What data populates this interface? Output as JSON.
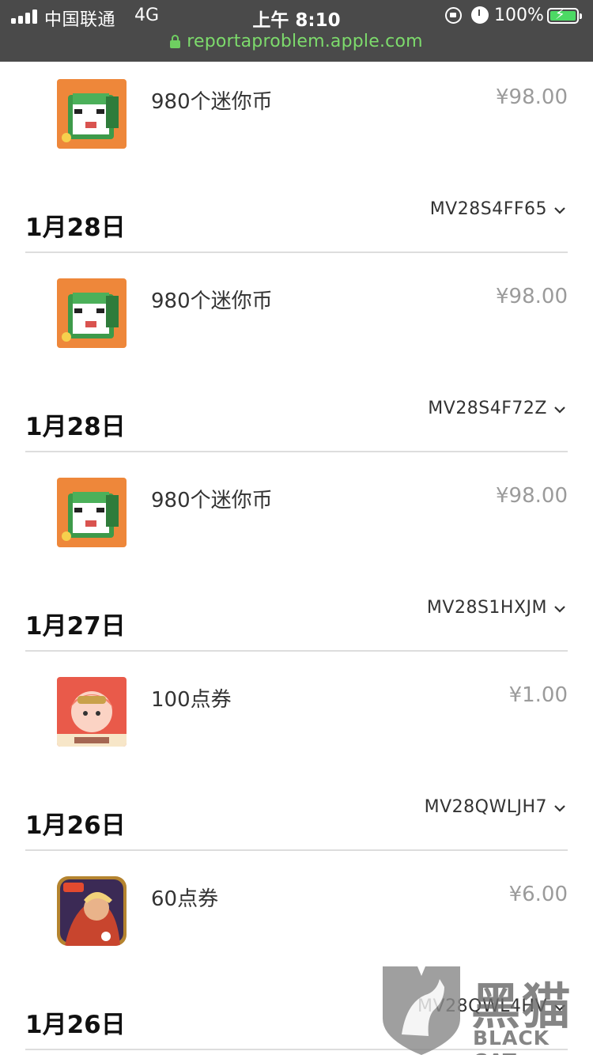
{
  "status_bar": {
    "carrier": "中国联通",
    "network": "4G",
    "time": "上午 8:10",
    "battery_percent": "100%"
  },
  "url_bar": {
    "url": "reportaproblem.apple.com"
  },
  "top_item": {
    "name": "980个迷你币",
    "price": "¥98.00",
    "icon": "mini-world-app-icon"
  },
  "groups": [
    {
      "date": "1月28日",
      "order_id": "MV28S4FF65",
      "item": {
        "name": "980个迷你币",
        "price": "¥98.00",
        "icon": "mini-world-app-icon"
      }
    },
    {
      "date": "1月28日",
      "order_id": "MV28S4F72Z",
      "item": {
        "name": "980个迷你币",
        "price": "¥98.00",
        "icon": "mini-world-app-icon"
      }
    },
    {
      "date": "1月27日",
      "order_id": "MV28S1HXJM",
      "item": {
        "name": "100点券",
        "price": "¥1.00",
        "icon": "journey-west-app-icon"
      }
    },
    {
      "date": "1月26日",
      "order_id": "MV28QWLJH7",
      "item": {
        "name": "60点券",
        "price": "¥6.00",
        "icon": "honor-of-kings-app-icon"
      }
    },
    {
      "date": "1月26日",
      "order_id": "MV28QWL4HV"
    }
  ],
  "watermark": {
    "text_cn": "黑猫",
    "text_en": "BLACK CAT"
  }
}
